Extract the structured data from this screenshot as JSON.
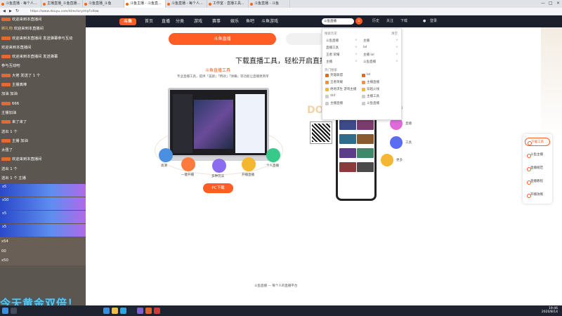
{
  "browser": {
    "tabs": [
      {
        "label": "斗鱼直播 - 每个人..."
      },
      {
        "label": "主播直播_斗鱼直播..."
      },
      {
        "label": "斗鱼直播_斗鱼"
      },
      {
        "label": "斗鱼主播 - 斗鱼直..."
      },
      {
        "label": "斗鱼直播 - 每个人..."
      },
      {
        "label": "工作室 - 直播工具..."
      },
      {
        "label": "斗鱼直播 - 斗鱼"
      }
    ],
    "url": "https://www.douyu.com/directory/myFollow"
  },
  "navbar": {
    "logo": "斗鱼",
    "items": [
      "首页",
      "直播",
      "分类",
      "游戏",
      "赛事",
      "娱乐",
      "鱼吧",
      "斗鱼游戏"
    ],
    "search_value": "斗鱼直播",
    "right_items": [
      "历史",
      "关注",
      "下载",
      "登录"
    ]
  },
  "chat": {
    "messages": [
      {
        "name": "",
        "text": "欢迎来到本直播间"
      },
      {
        "name": "刷礼物",
        "text": "欢迎来到本直播间"
      },
      {
        "name": "",
        "text": "欢迎来到本直播间 发送弹幕参与互动"
      },
      {
        "name": "",
        "text": "欢迎来到本直播间"
      },
      {
        "name": "",
        "text": "欢迎来到本直播间 发送弹幕"
      },
      {
        "name": "",
        "text": "参与互动吧"
      },
      {
        "name": "",
        "text": "大佬 发送了 1 个"
      },
      {
        "name": "",
        "text": "主播真棒"
      },
      {
        "name": "",
        "text": "加油 加油"
      },
      {
        "name": "",
        "text": "666"
      },
      {
        "name": "",
        "text": "主播加油"
      },
      {
        "name": "",
        "text": "来了来了"
      },
      {
        "name": "",
        "text": "送出 1 个"
      },
      {
        "name": "",
        "text": "主播 加油"
      },
      {
        "name": "",
        "text": "太强了"
      },
      {
        "name": "",
        "text": "欢迎来到本直播间"
      },
      {
        "name": "",
        "text": "送出 1 个"
      },
      {
        "name": "",
        "text": "送出 1 个 主播"
      }
    ],
    "banners": [
      "x5",
      "x50",
      "x5",
      "x5"
    ],
    "tail": [
      {
        "text": "x54"
      },
      {
        "text": "00"
      },
      {
        "text": "x50"
      }
    ]
  },
  "hero": {
    "tab_active": "斗鱼直播",
    "headline": "下载直播工具，轻松开启直播",
    "sub_title": "斗鱼直播工具",
    "sub_desc": "专业直播工具，提供「美颜」「特效」「弹幕」等功能让直播更简单",
    "features": [
      "高清",
      "一键开播",
      "多种玩法",
      "开播直播",
      "个人直播"
    ],
    "download_button": "PC下载",
    "dou_text": "DOU",
    "app_labels": [
      "主播",
      "直播",
      "工具",
      "更多"
    ]
  },
  "dropdown": {
    "history_title": "搜索历史",
    "clear_label": "清空",
    "history": [
      [
        "斗鱼直播",
        "主播"
      ],
      [
        "直播工具",
        "lol"
      ],
      [
        "王者 荣耀",
        "主播 lol"
      ],
      [
        "主播",
        "斗鱼直播"
      ]
    ],
    "hot_title": "热门搜索",
    "hot": [
      [
        "英雄联盟",
        "lol"
      ],
      [
        "王者荣耀",
        "主播直播"
      ],
      [
        "绝地求生 游戏主播",
        "穿越火线"
      ],
      [
        "dnf",
        "主播工具"
      ],
      [
        "主播直播",
        "斗鱼直播"
      ]
    ]
  },
  "right_menu": [
    "下载工具",
    "斗鱼主播",
    "直播规范",
    "直播教程",
    "开播攻略"
  ],
  "footer": {
    "text": "斗鱼直播 — 每个人的直播平台"
  },
  "overlay": {
    "text": "今天黄金双倍！"
  },
  "taskbar": {
    "time": "19:46",
    "date": "2020/8/14"
  },
  "colors": {
    "accent": "#ff5d23",
    "nav_bg": "#1c1f2c",
    "chat_bg": "#5b5650"
  }
}
